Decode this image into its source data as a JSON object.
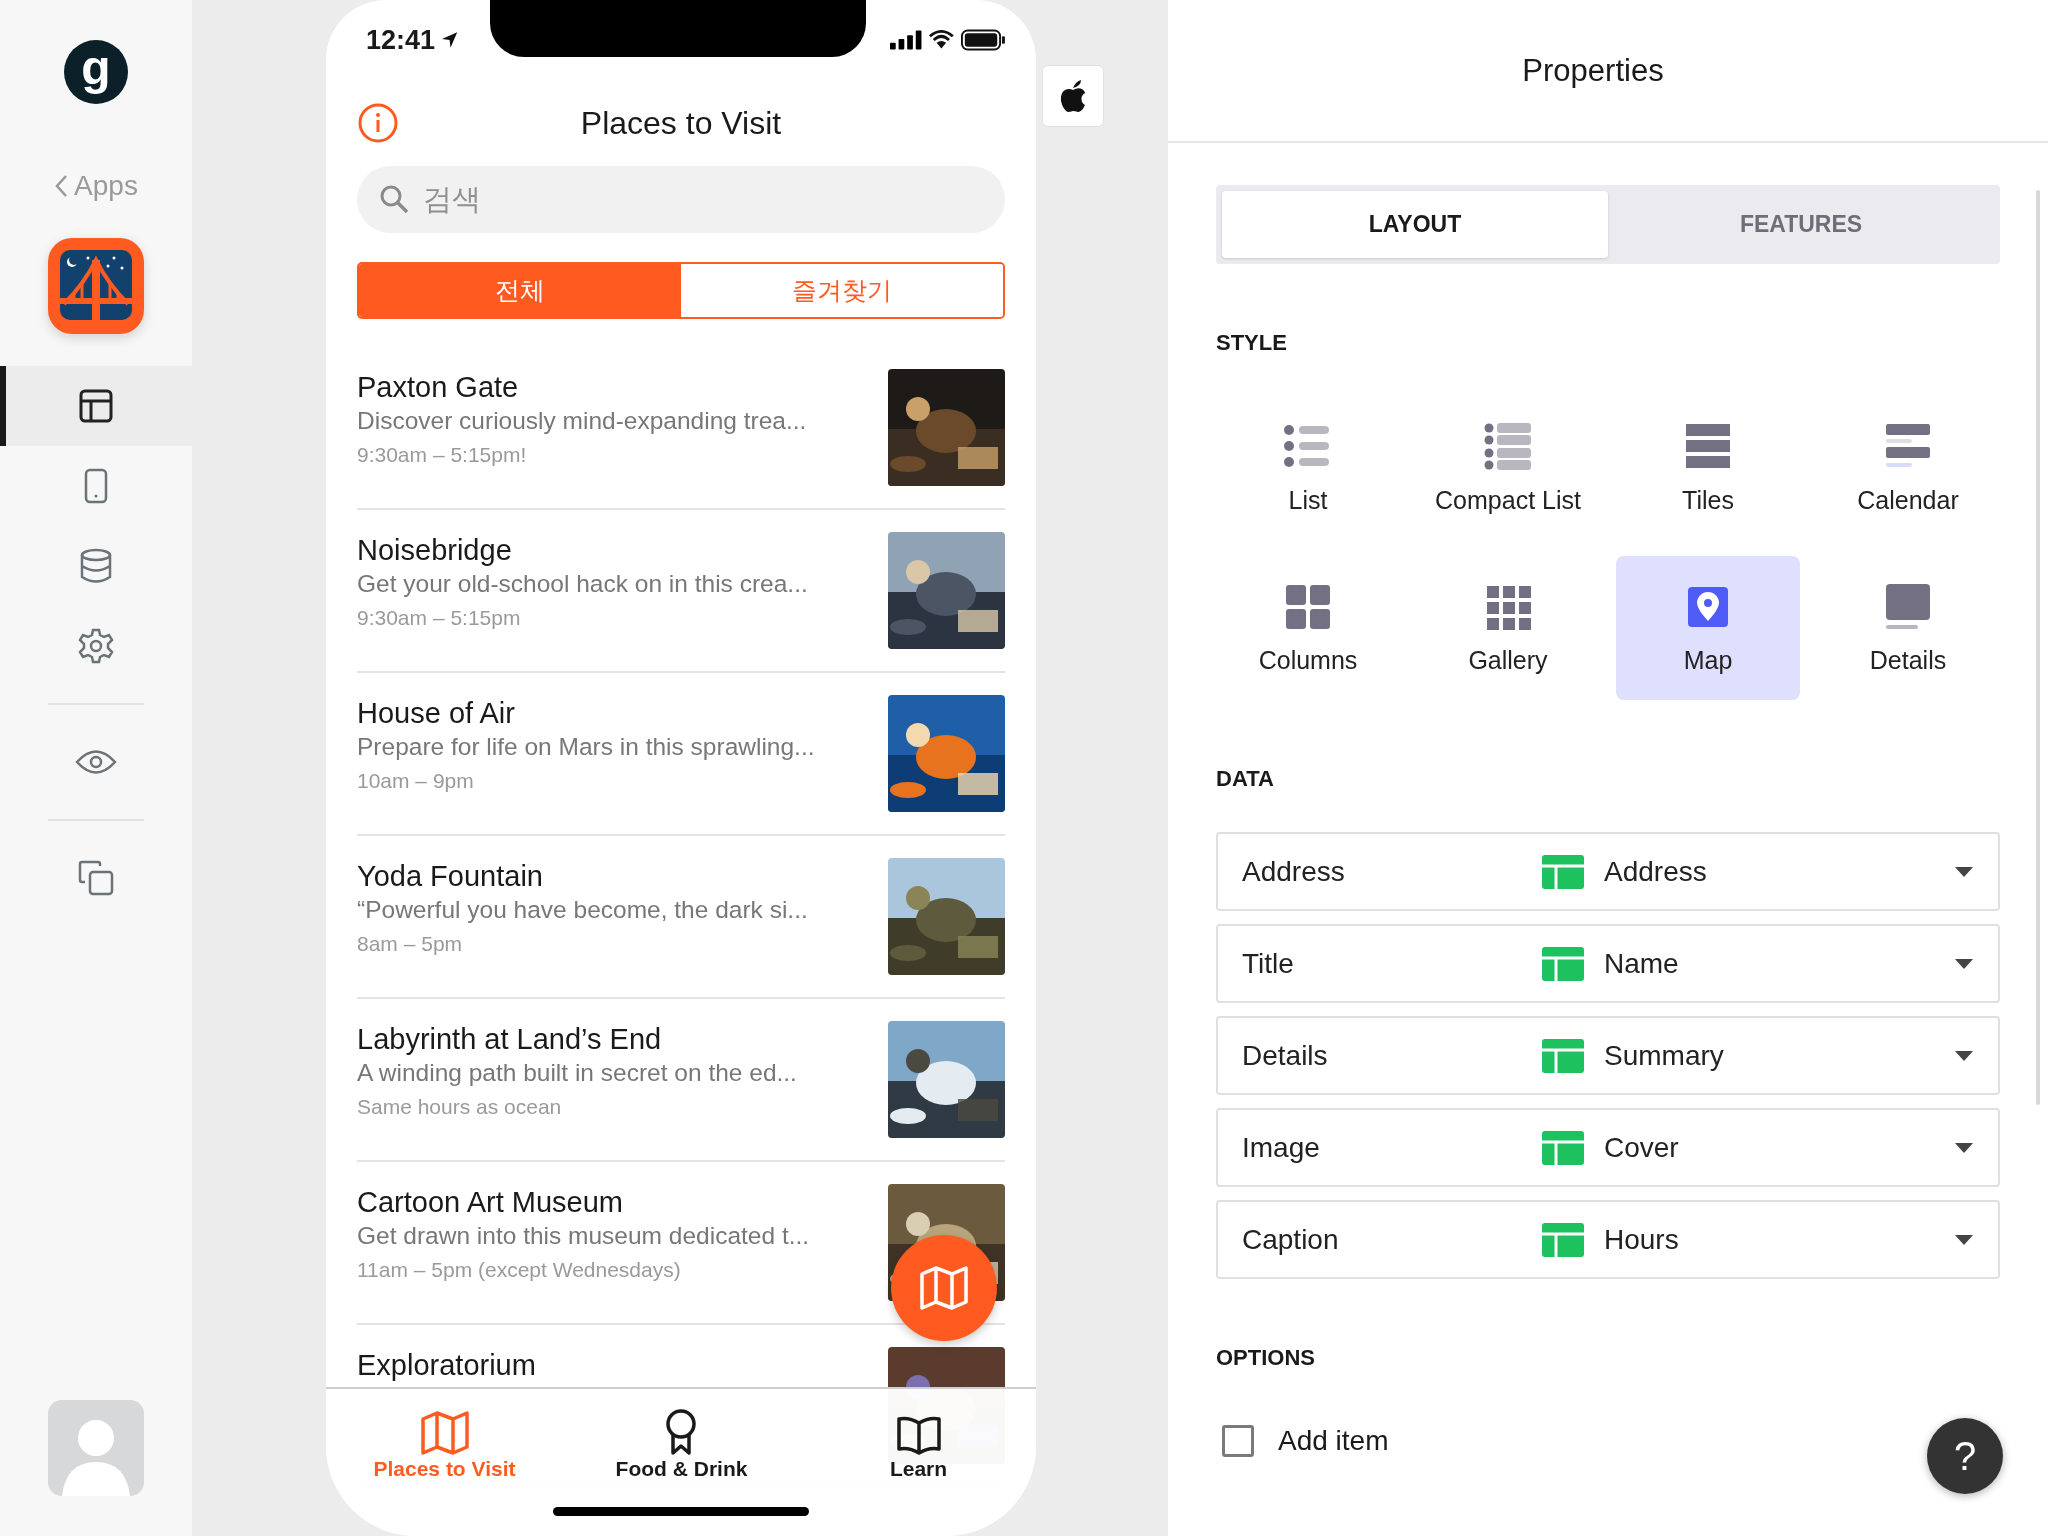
{
  "sidebar": {
    "logo": "g",
    "back": "Apps",
    "nav_groups": [
      [
        {
          "kind": "layout",
          "selected": true
        },
        {
          "kind": "phone",
          "selected": false
        },
        {
          "kind": "database",
          "selected": false
        },
        {
          "kind": "settings",
          "selected": false
        }
      ],
      [
        {
          "kind": "eye",
          "selected": false
        }
      ],
      [
        {
          "kind": "copy",
          "selected": false
        }
      ]
    ]
  },
  "phone": {
    "time": "12:41",
    "title": "Places to Visit",
    "search": {
      "placeholder": "검색"
    },
    "segments": [
      {
        "label": "전체",
        "selected": true
      },
      {
        "label": "즐겨찾기",
        "selected": false
      }
    ],
    "places": [
      {
        "name": "Paxton Gate",
        "summary": "Discover curiously mind-expanding trea...",
        "hours": "9:30am – 5:15pm!"
      },
      {
        "name": "Noisebridge",
        "summary": "Get your old-school hack on in this crea...",
        "hours": "9:30am – 5:15pm"
      },
      {
        "name": "House of Air",
        "summary": "Prepare for life on Mars in this sprawling...",
        "hours": "10am – 9pm"
      },
      {
        "name": "Yoda Fountain",
        "summary": "“Powerful you have become, the dark si...",
        "hours": "8am – 5pm"
      },
      {
        "name": "Labyrinth at Land’s End",
        "summary": "A winding path built in secret on the ed...",
        "hours": "Same hours as ocean"
      },
      {
        "name": "Cartoon Art Museum",
        "summary": "Get drawn into this museum dedicated t...",
        "hours": "11am – 5pm (except Wednesdays)"
      },
      {
        "name": "Exploratorium"
      }
    ],
    "tabs": [
      {
        "kind": "map",
        "label": "Places to Visit",
        "selected": true
      },
      {
        "kind": "award",
        "label": "Food & Drink",
        "selected": false
      },
      {
        "kind": "book",
        "label": "Learn",
        "selected": false
      }
    ]
  },
  "properties": {
    "title": "Properties",
    "tabs": [
      {
        "label": "LAYOUT",
        "selected": true
      },
      {
        "label": "FEATURES",
        "selected": false
      }
    ],
    "style_heading": "STYLE",
    "styles": [
      {
        "kind": "list",
        "label": "List",
        "selected": false
      },
      {
        "kind": "compact",
        "label": "Compact List",
        "selected": false
      },
      {
        "kind": "tiles",
        "label": "Tiles",
        "selected": false
      },
      {
        "kind": "calendar",
        "label": "Calendar",
        "selected": false
      },
      {
        "kind": "columns",
        "label": "Columns",
        "selected": false
      },
      {
        "kind": "gallery",
        "label": "Gallery",
        "selected": false
      },
      {
        "kind": "map",
        "label": "Map",
        "selected": true
      },
      {
        "kind": "details",
        "label": "Details",
        "selected": false
      }
    ],
    "data_heading": "DATA",
    "fields": [
      {
        "label": "Address",
        "column": "Address"
      },
      {
        "label": "Title",
        "column": "Name"
      },
      {
        "label": "Details",
        "column": "Summary"
      },
      {
        "label": "Image",
        "column": "Cover"
      },
      {
        "label": "Caption",
        "column": "Hours"
      }
    ],
    "options_heading": "OPTIONS",
    "options": [
      {
        "label": "Add item",
        "checked": false
      }
    ],
    "help": "?"
  }
}
